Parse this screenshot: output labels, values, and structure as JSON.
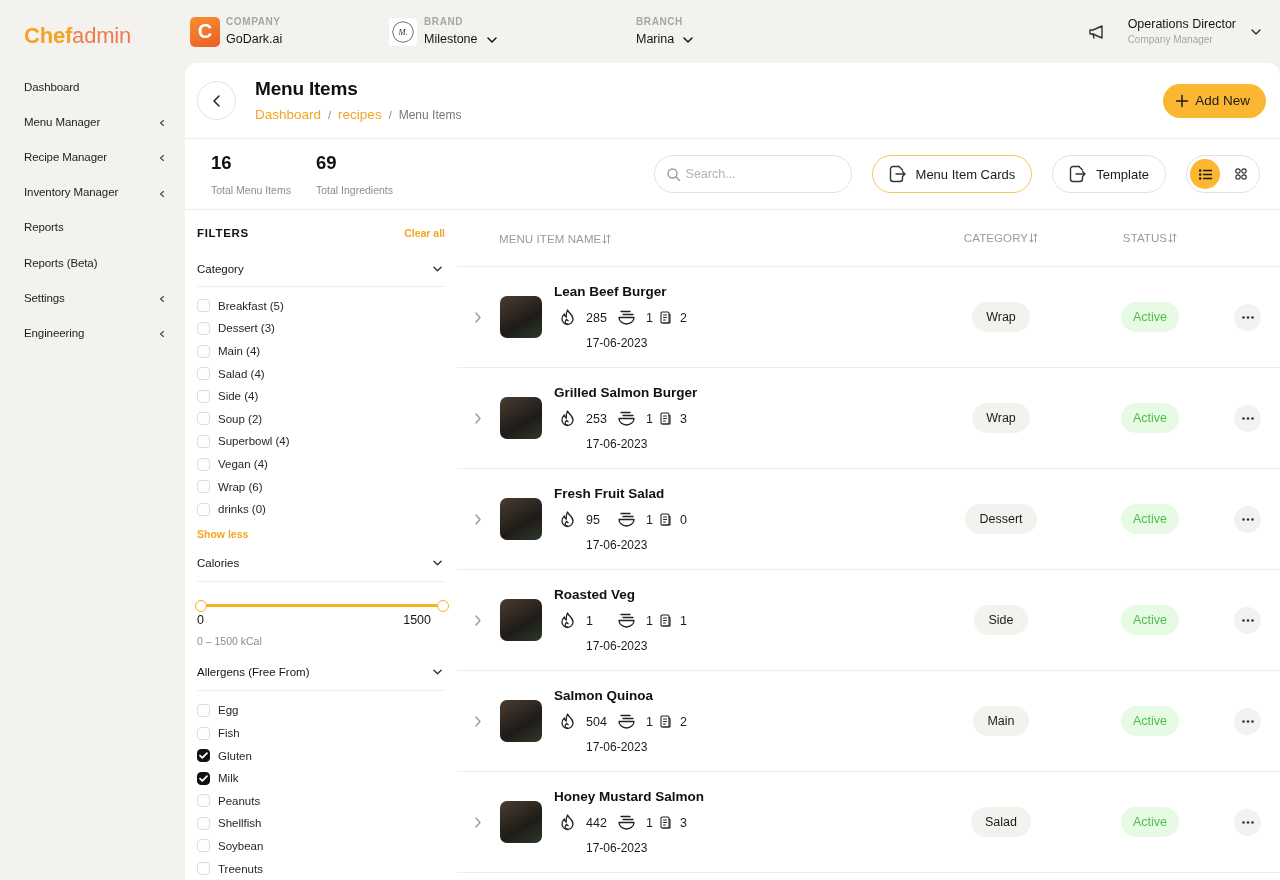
{
  "sidebar": {
    "logo": "**Chef**admin",
    "items": [
      {
        "label": "Dashboard",
        "has_submenu": false
      },
      {
        "label": "Menu Manager",
        "has_submenu": true
      },
      {
        "label": "Recipe Manager",
        "has_submenu": true
      },
      {
        "label": "Inventory Manager",
        "has_submenu": true
      },
      {
        "label": "Reports",
        "has_submenu": false
      },
      {
        "label": "Reports (Beta)",
        "has_submenu": false
      },
      {
        "label": "Settings",
        "has_submenu": true
      },
      {
        "label": "Engineering",
        "has_submenu": true
      }
    ]
  },
  "topbar": {
    "company": {
      "logo": "C",
      "label": "COMPANY",
      "value": "GoDark.ai"
    },
    "brand": {
      "logo": "M.",
      "label": "BRAND",
      "value": "Milestone"
    },
    "branch": {
      "label": "BRANCH",
      "value": "Marina"
    },
    "user": {
      "name": "Operations Director",
      "role": "Company Manager"
    }
  },
  "header": {
    "title": "Menu Items",
    "breadcrumb": [
      {
        "label": "Dashboard",
        "kind": "link"
      },
      {
        "label": "recipes",
        "kind": "link",
        "separator": "/"
      },
      {
        "label": "Menu Items",
        "kind": "current",
        "separator": "/"
      }
    ],
    "add_button": "Add New"
  },
  "stats": [
    {
      "value": "16",
      "label": "Total Menu Items"
    },
    {
      "value": "69",
      "label": "Total Ingredients"
    }
  ],
  "toolbar": {
    "search": {
      "placeholder": "Search..."
    },
    "buttons": [
      {
        "label": "Menu Item Cards",
        "selected": true
      },
      {
        "label": "Template",
        "selected": false
      }
    ],
    "view_toggle": [
      {
        "kind": "list",
        "selected": true
      },
      {
        "kind": "grid",
        "selected": false
      }
    ]
  },
  "filters": {
    "title": "FILTERS",
    "clear": "Clear all",
    "category": {
      "title": "Category",
      "expanded": true,
      "options": [
        {
          "label": "Breakfast (5)",
          "checked": false
        },
        {
          "label": "Dessert (3)",
          "checked": false
        },
        {
          "label": "Main (4)",
          "checked": false
        },
        {
          "label": "Salad (4)",
          "checked": false
        },
        {
          "label": "Side (4)",
          "checked": false
        },
        {
          "label": "Soup (2)",
          "checked": false
        },
        {
          "label": "Superbowl (4)",
          "checked": false
        },
        {
          "label": "Vegan (4)",
          "checked": false
        },
        {
          "label": "Wrap (6)",
          "checked": false
        },
        {
          "label": "drinks (0)",
          "checked": false
        }
      ],
      "toggle": "Show less"
    },
    "calories": {
      "title": "Calories",
      "expanded": true,
      "thumbs": [
        {
          "level": 0
        },
        {
          "level": 1
        }
      ],
      "min_label": "0",
      "max_label": "1500",
      "range": "0 – 1500 kCal"
    },
    "allergens": {
      "title": "Allergens (Free From)",
      "expanded": true,
      "options": [
        {
          "label": "Egg",
          "checked": false
        },
        {
          "label": "Fish",
          "checked": false
        },
        {
          "label": "Gluten",
          "checked": true
        },
        {
          "label": "Milk",
          "checked": true
        },
        {
          "label": "Peanuts",
          "checked": false
        },
        {
          "label": "Shellfish",
          "checked": false
        },
        {
          "label": "Soybean",
          "checked": false
        },
        {
          "label": "Treenuts",
          "checked": false
        }
      ]
    }
  },
  "table": {
    "columns": [
      {
        "label": "MENU ITEM NAME"
      },
      {
        "label": "CATEGORY"
      },
      {
        "label": "STATUS"
      }
    ],
    "rows": [
      {
        "name": "Lean Beef Burger",
        "calories": "285",
        "bowls": "1",
        "documents": "2",
        "date": "17-06-2023",
        "category": "Wrap",
        "status": "Active"
      },
      {
        "name": "Grilled Salmon Burger",
        "calories": "253",
        "bowls": "1",
        "documents": "3",
        "date": "17-06-2023",
        "category": "Wrap",
        "status": "Active"
      },
      {
        "name": "Fresh Fruit Salad",
        "calories": "95",
        "bowls": "1",
        "documents": "0",
        "date": "17-06-2023",
        "category": "Dessert",
        "status": "Active"
      },
      {
        "name": "Roasted Veg",
        "calories": "1",
        "bowls": "1",
        "documents": "1",
        "date": "17-06-2023",
        "category": "Side",
        "status": "Active"
      },
      {
        "name": "Salmon Quinoa",
        "calories": "504",
        "bowls": "1",
        "documents": "2",
        "date": "17-06-2023",
        "category": "Main",
        "status": "Active"
      },
      {
        "name": "Honey Mustard Salmon",
        "calories": "442",
        "bowls": "1",
        "documents": "3",
        "date": "17-06-2023",
        "category": "Salad",
        "status": "Active"
      }
    ]
  }
}
